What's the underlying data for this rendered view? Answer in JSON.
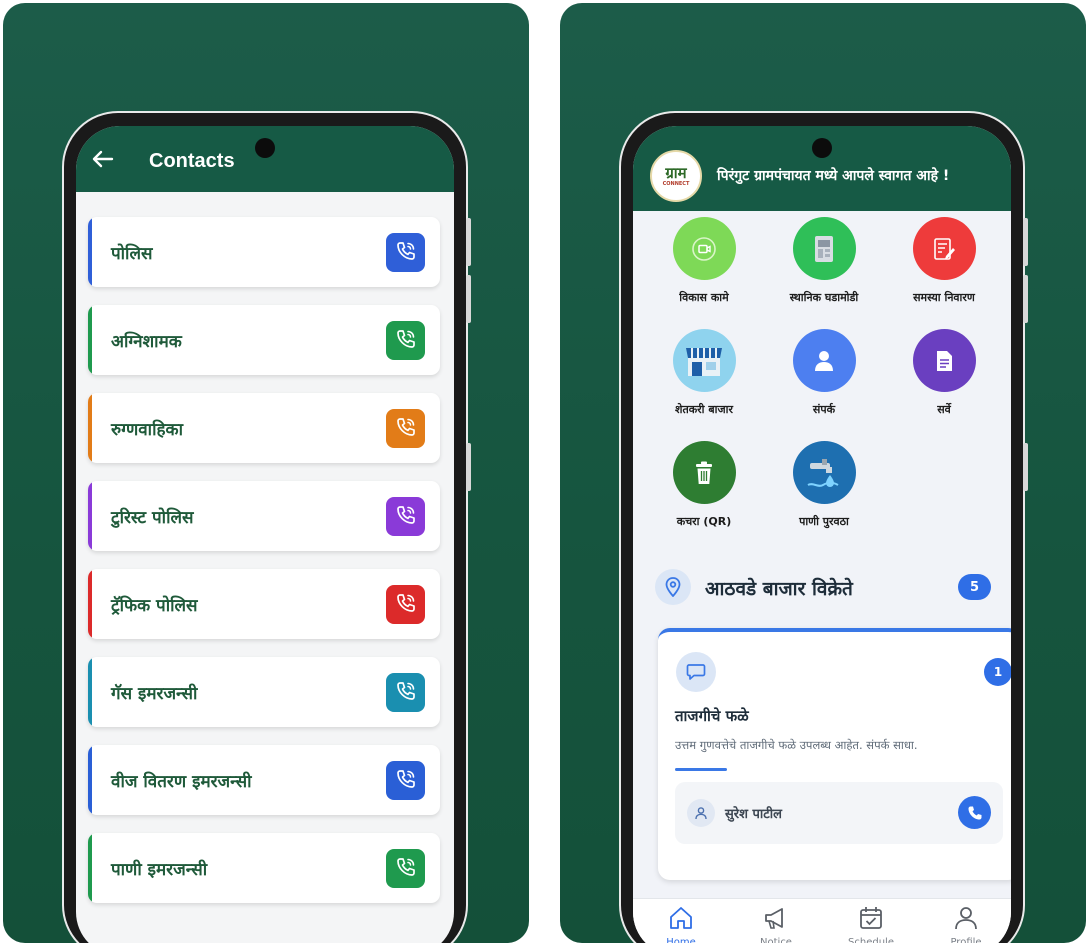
{
  "colors": {
    "panel_bg": "#1c5c49",
    "app_green": "#165a45",
    "accent_blue": "#2f6ee6",
    "contact_text": "#1f5a3a"
  },
  "contacts_screen": {
    "title": "Contacts",
    "back_icon": "arrow-left-icon",
    "items": [
      {
        "label": "पोलिस",
        "color": "#2f5fd8",
        "icon": "phone-call-icon"
      },
      {
        "label": "अग्निशामक",
        "color": "#1f9a4e",
        "icon": "phone-call-icon"
      },
      {
        "label": "रुग्णवाहिका",
        "color": "#e27c18",
        "icon": "phone-call-icon"
      },
      {
        "label": "टुरिस्ट पोलिस",
        "color": "#8a3ad8",
        "icon": "phone-call-icon"
      },
      {
        "label": "ट्रॅफिक पोलिस",
        "color": "#dc2a2a",
        "icon": "phone-call-icon"
      },
      {
        "label": "गॅस इमरजन्सी",
        "color": "#1a8fb0",
        "icon": "phone-call-icon"
      },
      {
        "label": "वीज वितरण इमरजन्सी",
        "color": "#2a5fd6",
        "icon": "phone-call-icon"
      },
      {
        "label": "पाणी इमरजन्सी",
        "color": "#1f9a4e",
        "icon": "phone-call-icon"
      }
    ]
  },
  "home_screen": {
    "logo_text": "ग्राम",
    "logo_subtext": "CONNECT",
    "welcome": "पिरंगुट ग्रामपंचायत मध्ये आपले स्वागत आहे !",
    "tiles": [
      {
        "label": "विकास कामे",
        "color": "#7ed957",
        "icon": "video-icon"
      },
      {
        "label": "स्थानिक घडामोडी",
        "color": "#2fbf58",
        "icon": "news-icon"
      },
      {
        "label": "समस्या निवारण",
        "color": "#ee3b3b",
        "icon": "edit-document-icon"
      },
      {
        "label": "शेतकरी बाजार",
        "color": "#8fd3ee",
        "icon": "market-icon"
      },
      {
        "label": "संपर्क",
        "color": "#4d7ff0",
        "icon": "person-icon"
      },
      {
        "label": "सर्वे",
        "color": "#6a3fc0",
        "icon": "survey-icon"
      },
      {
        "label": "कचरा (QR)",
        "color": "#2e7d32",
        "icon": "trash-icon"
      },
      {
        "label": "पाणी पुरवठा",
        "color": "#1e6fb0",
        "icon": "water-tap-icon"
      }
    ],
    "section": {
      "title": "आठवडे बाजार विक्रेते",
      "count": "5",
      "icon": "location-pin-icon"
    },
    "vendor": {
      "badge": "1",
      "title": "ताजगीचे फळे",
      "description": "उत्तम गुणवत्तेचे ताजगीचे फळे उपलब्ध आहेत. संपर्क साधा.",
      "seller": "सुरेश पाटील",
      "icon": "chat-icon"
    },
    "nav": [
      {
        "label": "Home",
        "icon": "home-icon",
        "active": true
      },
      {
        "label": "Notice",
        "icon": "megaphone-icon",
        "active": false
      },
      {
        "label": "Schedule",
        "icon": "calendar-check-icon",
        "active": false
      },
      {
        "label": "Profile",
        "icon": "user-icon",
        "active": false
      }
    ]
  }
}
